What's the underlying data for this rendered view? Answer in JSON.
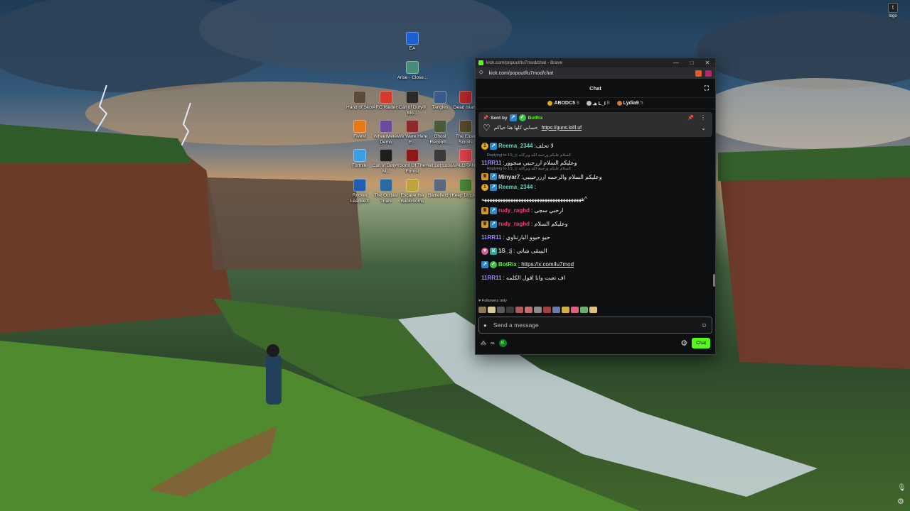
{
  "desktop": {
    "logo_label": "logo",
    "icons": [
      {
        "label": "EA",
        "color": "#1b5fd1"
      },
      {
        "label": "Arise - Close...",
        "color": "#4a8c7a"
      },
      {
        "label": "Hand of Skor",
        "color": "#5a4a3a"
      },
      {
        "label": "ARC Raiders",
        "color": "#d43b2a"
      },
      {
        "label": "Call of Duty® Mo...",
        "color": "#2a2a2a"
      },
      {
        "label": "Tangles",
        "color": "#3a5b8a"
      },
      {
        "label": "Dead Island",
        "color": "#b52a2a"
      },
      {
        "label": "FiveM",
        "color": "#e67817"
      },
      {
        "label": "WheelMeter Demo",
        "color": "#6a4a9a"
      },
      {
        "label": "We Were Here E...",
        "color": "#8a2a2a"
      },
      {
        "label": "Ghost Recon®...",
        "color": "#4a5a3a"
      },
      {
        "label": "The Elder Scrolls",
        "color": "#5a4a2a"
      },
      {
        "label": "Fortnite",
        "color": "#3aa0e6"
      },
      {
        "label": "Call of Duty® M...",
        "color": "#1e1e1e"
      },
      {
        "label": "Sons Of The Forest",
        "color": "#8a1a1a"
      },
      {
        "label": "Hell Let Loose",
        "color": "#3a3a3a"
      },
      {
        "label": "VALORANT",
        "color": "#e0434a"
      },
      {
        "label": "Rocket League®",
        "color": "#1f5fb3"
      },
      {
        "label": "The Outlast Trials",
        "color": "#2a6aa0"
      },
      {
        "label": "Escape the Backrooms",
        "color": "#c0a23a"
      },
      {
        "label": "Battlefield 6",
        "color": "#5a6a7a"
      },
      {
        "label": "Keep Digging",
        "color": "#4a8a3a"
      }
    ]
  },
  "browser": {
    "title": "kick.com/popout/lu7mod/chat - Brave",
    "url": "kick.com/popout/lu7mod/chat",
    "controls": {
      "minimize": "—",
      "maximize": "□",
      "close": "✕"
    }
  },
  "chat": {
    "header": "Chat",
    "leaderboard": [
      {
        "name": "ABODC5",
        "count": "8",
        "color": "#e3a81a"
      },
      {
        "name": "هـ L_I",
        "count": "8",
        "color": "#c0c0c0"
      },
      {
        "name": "Lydia9",
        "count": "5",
        "color": "#c87a3a"
      }
    ],
    "pinned": {
      "sent_by_label": "Sent by",
      "sender": "BotRix",
      "message": "حسابي كلها هنا حياكم",
      "link": "https://guns.lol/l.uf"
    },
    "messages": [
      {
        "badges": [
          "gold",
          "blue"
        ],
        "user": "Reema_2344",
        "user_color": "#60d7b3",
        "text": ":لا تحلف",
        "reply": ""
      },
      {
        "badges": [],
        "user": "11RR11",
        "user_color": "#9b8cff",
        "text": ":وعليكم السلام اررحبيي سجوور",
        "reply": "Replying to 1S_:j: السلام عليكم ورحمة الله وبركاته"
      },
      {
        "badges": [
          "crown",
          "blue"
        ],
        "user": "Minyar7",
        "user_color": "#e0e0e0",
        "text": ":وعليكم السلام والرحمه ارررحبيبي",
        "reply": "Replying to 1S_:j: السلام عليكم ورحمة الله وبركاته"
      },
      {
        "badges": [
          "gold",
          "blue"
        ],
        "user": "Reema_2344",
        "user_color": "#60d7b3",
        "text": ":",
        "reply": ""
      },
      {
        "badges": [],
        "user": "",
        "user_color": "#e0e0e0",
        "text": "ههههههههههههههههههههههههههههههههههههههه^",
        "reply": ""
      },
      {
        "badges": [
          "crown",
          "blue"
        ],
        "user": "rudy_raghd",
        "user_color": "#ff3d6e",
        "text": ": ارحبي سجى",
        "reply": ""
      },
      {
        "badges": [
          "crown",
          "blue"
        ],
        "user": "rudy_raghd",
        "user_color": "#ff3d6e",
        "text": ": وعليكم السلام",
        "reply": ""
      },
      {
        "badges": [],
        "user": "11RR11",
        "user_color": "#9b8cff",
        "text": ": حيو حيوو البارتناوي",
        "reply": ""
      },
      {
        "badges": [
          "pink",
          "teal"
        ],
        "user": "1S_:j",
        "user_color": "#e0e0e0",
        "text": ": البيبقى شاتي",
        "reply": ""
      },
      {
        "badges": [
          "blue",
          "green"
        ],
        "user": "BotRix",
        "user_color": "#53fc18",
        "text": ": https://x.com/lu7mod",
        "reply": "",
        "is_link": true
      },
      {
        "badges": [],
        "user": "11RR11",
        "user_color": "#9b8cff",
        "text": ": اف تعبت وانا اقول الكلمه",
        "reply": ""
      }
    ],
    "followers_only": "Followers only",
    "emote_colors": [
      "#8a7a5a",
      "#d8c8a0",
      "#5a5a5a",
      "#3a3a3a",
      "#b05a5a",
      "#c07070",
      "#8a8a8a",
      "#a04040",
      "#6a7ab0",
      "#d0b040",
      "#e06080",
      "#6ab06a",
      "#e0c080"
    ],
    "input_placeholder": "Send a message",
    "send_label": "Chat",
    "points_label": "∞"
  }
}
